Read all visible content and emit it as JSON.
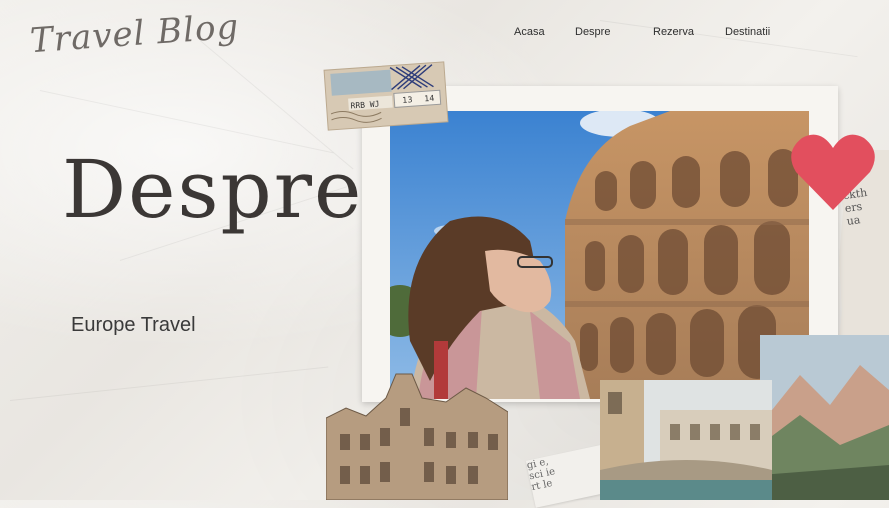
{
  "brand": {
    "logo_text": "Travel Blog"
  },
  "nav": {
    "items": [
      {
        "label": "Acasa"
      },
      {
        "label": "Despre"
      },
      {
        "label": "Rezerva"
      },
      {
        "label": "Destinatii"
      }
    ]
  },
  "hero": {
    "title": "Despre",
    "subtitle": "Europe Travel"
  },
  "collage": {
    "tape_numbers": [
      "13",
      "14"
    ],
    "newsprint_right": "ckth",
    "newsprint_bottom": "ie"
  },
  "colors": {
    "background": "#eeebe6",
    "text_dark": "#3b3735",
    "heart": "#e0505e",
    "sky": "#3d86d4",
    "stone": "#b98a5c"
  }
}
